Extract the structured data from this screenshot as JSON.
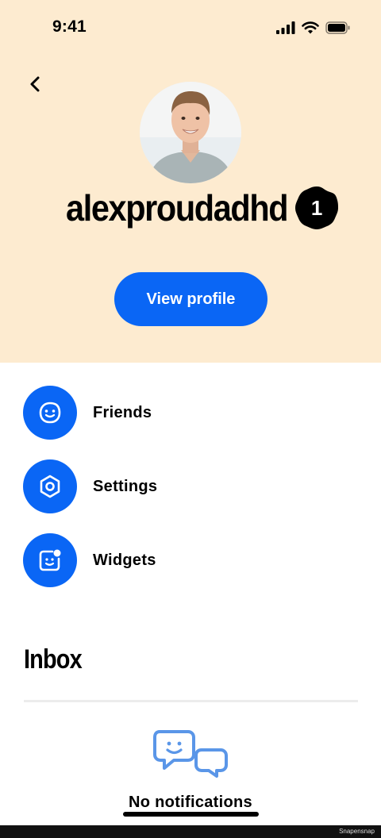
{
  "status_bar": {
    "time": "9:41",
    "icons": [
      "signal-icon",
      "wifi-icon",
      "battery-icon"
    ]
  },
  "header": {
    "background": "#fdebd0",
    "username": "alexproudadhd",
    "badge_count": "1",
    "view_profile_label": "View profile"
  },
  "menu": {
    "items": [
      {
        "label": "Friends",
        "icon": "smiley-icon"
      },
      {
        "label": "Settings",
        "icon": "hexagon-gear-icon"
      },
      {
        "label": "Widgets",
        "icon": "widget-icon"
      }
    ]
  },
  "inbox": {
    "title": "Inbox",
    "empty_text": "No notifications",
    "empty_subtext": ""
  },
  "watermark": "Snapensnap",
  "colors": {
    "accent": "#0a66f5",
    "header_bg": "#fdebd0",
    "empty_icon": "#5a96e8"
  }
}
